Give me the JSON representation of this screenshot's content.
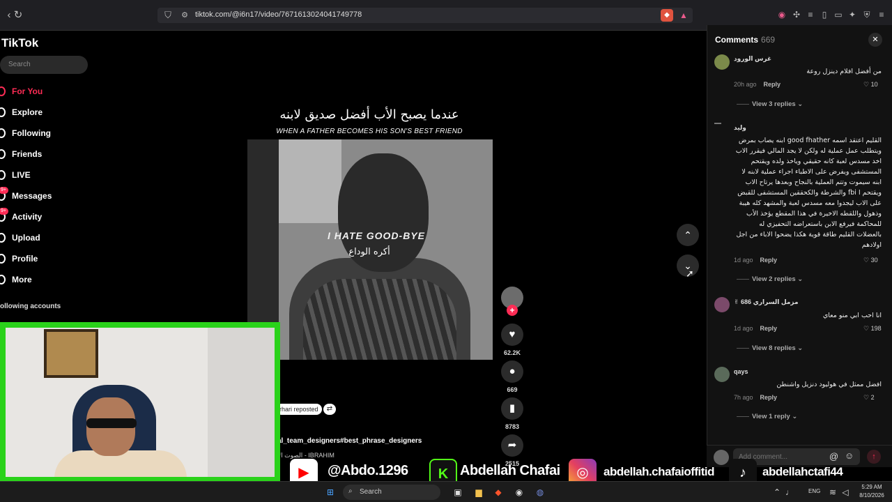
{
  "browser": {
    "url": "tiktok.com/@i6n17/video/7671613024041749778"
  },
  "sidebar": {
    "logo": "TikTok",
    "search_placeholder": "Search",
    "items": [
      {
        "label": "For You",
        "icon": "home-icon",
        "active": true
      },
      {
        "label": "Explore",
        "icon": "compass-icon"
      },
      {
        "label": "Following",
        "icon": "following-icon"
      },
      {
        "label": "Friends",
        "icon": "friends-icon"
      },
      {
        "label": "LIVE",
        "icon": "live-icon"
      },
      {
        "label": "Messages",
        "icon": "messages-icon",
        "badge": "9+"
      },
      {
        "label": "Activity",
        "icon": "activity-icon",
        "badge": "9+"
      },
      {
        "label": "Upload",
        "icon": "upload-icon"
      },
      {
        "label": "Profile",
        "icon": "profile-icon"
      },
      {
        "label": "More",
        "icon": "more-icon"
      }
    ],
    "following_accounts": "ollowing accounts"
  },
  "video": {
    "title_ar": "عندما يصبح الأب أفضل صديق لابنه",
    "title_en": "WHEN A FATHER BECOMES HIS SON'S BEST FRIEND",
    "subtitle_en": "I HATE GOOD-BYE",
    "subtitle_ar": "أكره الوداع",
    "repost_label": "rhari reposted",
    "hashtags": "al_team_designers#best_phrase_designers",
    "music": "الصوت الأ - IBRAHIM"
  },
  "actions": {
    "likes": "62.2K",
    "comments": "669",
    "saves": "8783",
    "shares": "2515"
  },
  "comments": {
    "title": "Comments",
    "count": "669",
    "items": [
      {
        "user": "غرس الورود",
        "text": "من أفضل افلام دينزل روعة",
        "time": "20h ago",
        "reply": "Reply",
        "likes": "10",
        "view_replies": "View 3 replies"
      },
      {
        "user": "وليد",
        "text": "القليم اعتقد اسمه good fhather ابنه يصاب بمرض ويتطلب عمل عملية له ولكن لا يجد المالي فيقرر الاب اخد مسدس لعبة كانه حقيقي وياخذ ولده ويقتحم المستشفى ويفرض على الاطباء اجراء عملية لابنه لا ابنه سيموت وتتم العملية بالنجاح وبعدها يرتاح الاب ويقتحم ا fbi والشرطة والكحققين المستشفى للقبض على الاب ليجدوا معه مسدس لعبة والمشهد كله هيبة وذهول واللقطه الاخيرة في هذا المقطع يؤخذ الأب للمحاكمة فيرفع الابن باستعراضه التحفيزي له بالعضلات القليم طاقة قوية هكذا يضحوا الاباء من اجل اولادهم",
        "time": "1d ago",
        "reply": "Reply",
        "likes": "30",
        "view_replies": "View 2 replies"
      },
      {
        "user": "مزمل السراري 686 ✌",
        "text": "انا احب ابي منو معاي",
        "time": "1d ago",
        "reply": "Reply",
        "likes": "198",
        "view_replies": "View 8 replies"
      },
      {
        "user": "qays",
        "text": "افضل ممثل في هوليود دنزيل واشنطن",
        "time": "7h ago",
        "reply": "Reply",
        "likes": "2",
        "view_replies": "View 1 reply"
      }
    ],
    "add_placeholder": "Add comment..."
  },
  "social": {
    "youtube": "@Abdo.1296",
    "kick": "Abdellah Chafai",
    "instagram": "abdellah.chafaioffitid",
    "tiktok": "abdellahctafi44"
  },
  "taskbar": {
    "search": "Search",
    "lang": "ENG",
    "time": "5:29 AM",
    "date": "8/10/2026"
  },
  "colors": {
    "accent": "#fe2c55",
    "webcam_border": "#2ad21a"
  }
}
